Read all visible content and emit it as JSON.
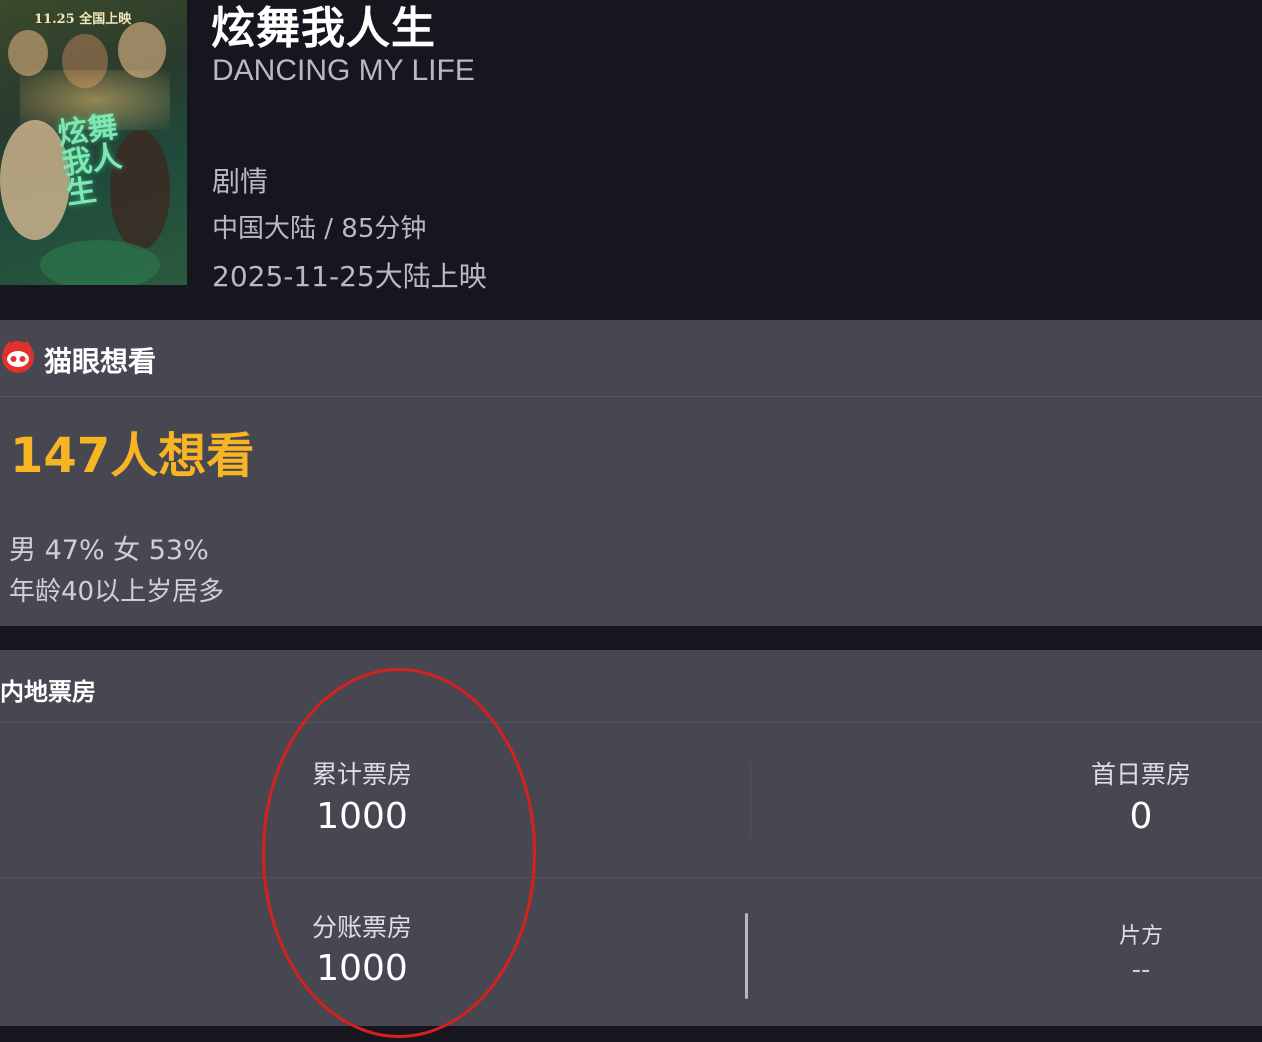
{
  "movie": {
    "poster_date": "11.25 全国上映",
    "poster_title": "炫舞我人生",
    "title_cn": "炫舞我人生",
    "title_en": "DANCING MY LIFE",
    "genre": "剧情",
    "meta": "中国大陆 / 85分钟",
    "release": "2025-11-25大陆上映"
  },
  "want_panel": {
    "brand_icon": "maoyan-cat-icon",
    "brand_name": "猫眼想看",
    "want_count": "147人想看",
    "gender_ratio": "男 47% 女 53%",
    "age_note": "年龄40以上岁居多"
  },
  "box_office": {
    "title": "内地票房",
    "cumulative_label": "累计票房",
    "cumulative_value": "1000",
    "first_day_label": "首日票房",
    "first_day_value": "0",
    "split_label": "分账票房",
    "split_value": "1000",
    "distributor_label": "片方",
    "distributor_value": "--"
  },
  "colors": {
    "background": "#16161f",
    "panel": "#474752",
    "want_count": "#f7b423",
    "annotation": "#d6201c",
    "brand": "#e0312b"
  }
}
